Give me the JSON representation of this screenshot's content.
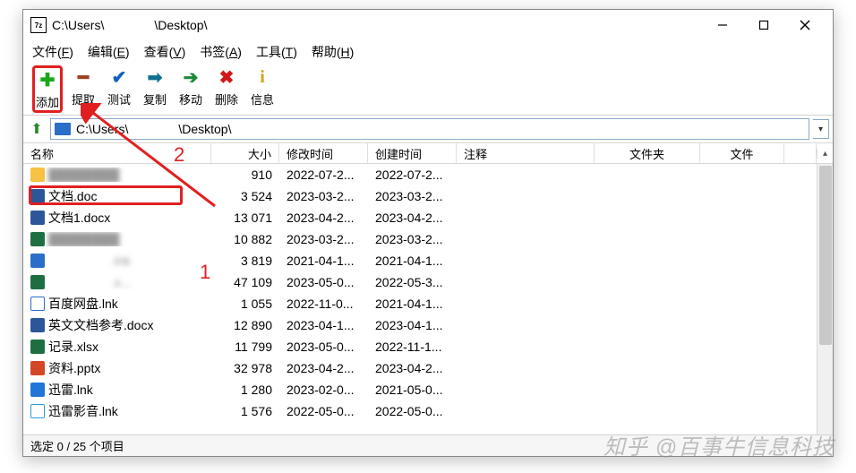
{
  "window": {
    "title": "C:\\Users\\　　　　\\Desktop\\",
    "app_icon_text": "7z"
  },
  "menubar": {
    "file": {
      "label": "文件",
      "accel": "F"
    },
    "edit": {
      "label": "编辑",
      "accel": "E"
    },
    "view": {
      "label": "查看",
      "accel": "V"
    },
    "bookmark": {
      "label": "书签",
      "accel": "A"
    },
    "tool": {
      "label": "工具",
      "accel": "T"
    },
    "help": {
      "label": "帮助",
      "accel": "H"
    }
  },
  "toolbar": {
    "add": {
      "label": "添加",
      "icon": "plus-icon",
      "color": "#18a818"
    },
    "extract": {
      "label": "提取",
      "icon": "minus-icon",
      "color": "#a04020"
    },
    "test": {
      "label": "测试",
      "icon": "check-icon",
      "color": "#1060c0"
    },
    "copy": {
      "label": "复制",
      "icon": "arrow-right-icon",
      "color": "#107090"
    },
    "move": {
      "label": "移动",
      "icon": "arrow-right-solid-icon",
      "color": "#1a8a3a"
    },
    "delete": {
      "label": "删除",
      "icon": "cross-icon",
      "color": "#d01818"
    },
    "info": {
      "label": "信息",
      "icon": "info-icon",
      "color": "#c8a818"
    }
  },
  "addrbar": {
    "path": "C:\\Users\\　　　　\\Desktop\\"
  },
  "columns": {
    "name": "名称",
    "size": "大小",
    "modified": "修改时间",
    "created": "创建时间",
    "note": "注释",
    "folder": "文件夹",
    "files": "文件"
  },
  "files": [
    {
      "icon": "fi-lnk",
      "name": "",
      "blur": true,
      "size": "910",
      "mod": "2022-07-2...",
      "cre": "2022-07-2..."
    },
    {
      "icon": "fi-docx",
      "name": "文档.doc",
      "blur": false,
      "size": "3 524",
      "mod": "2023-03-2...",
      "cre": "2023-03-2..."
    },
    {
      "icon": "fi-docx",
      "name": "文档1.docx",
      "blur": false,
      "size": "13 071",
      "mod": "2023-04-2...",
      "cre": "2023-04-2..."
    },
    {
      "icon": "fi-xlsx",
      "name": "",
      "blur": true,
      "size": "10 882",
      "mod": "2023-03-2...",
      "cre": "2023-03-2..."
    },
    {
      "icon": "fi-ie",
      "name": "　　　　　.lnk",
      "blur": true,
      "size": "3 819",
      "mod": "2021-04-1...",
      "cre": "2021-04-1..."
    },
    {
      "icon": "fi-xlsx",
      "name": "　　　　　.x...",
      "blur": true,
      "size": "47 109",
      "mod": "2023-05-0...",
      "cre": "2022-05-3..."
    },
    {
      "icon": "fi-cloud",
      "name": "百度网盘.lnk",
      "blur": false,
      "size": "1 055",
      "mod": "2022-11-0...",
      "cre": "2021-04-1..."
    },
    {
      "icon": "fi-docx",
      "name": "英文文档参考.docx",
      "blur": false,
      "size": "12 890",
      "mod": "2023-04-1...",
      "cre": "2023-04-1..."
    },
    {
      "icon": "fi-xlsx",
      "name": "记录.xlsx",
      "blur": false,
      "size": "11 799",
      "mod": "2023-05-0...",
      "cre": "2022-11-1..."
    },
    {
      "icon": "fi-pptx",
      "name": "资料.pptx",
      "blur": false,
      "size": "32 978",
      "mod": "2023-04-2...",
      "cre": "2023-04-2..."
    },
    {
      "icon": "fi-thunder",
      "name": "迅雷.lnk",
      "blur": false,
      "size": "1 280",
      "mod": "2023-02-0...",
      "cre": "2021-05-0..."
    },
    {
      "icon": "fi-media",
      "name": "迅雷影音.lnk",
      "blur": false,
      "size": "1 576",
      "mod": "2022-05-0...",
      "cre": "2022-05-0..."
    }
  ],
  "statusbar": {
    "text": "选定 0 / 25 个项目"
  },
  "annotations": {
    "label1": "1",
    "label2": "2"
  },
  "watermark": "知乎 @百事牛信息科技"
}
